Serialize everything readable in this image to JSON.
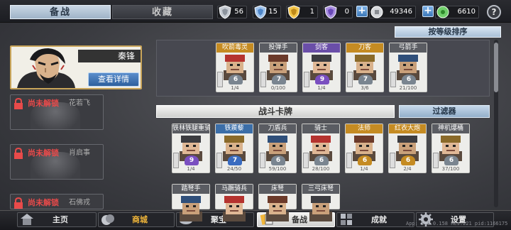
{
  "tabs": {
    "formation": "备战",
    "collection": "收藏"
  },
  "resources": {
    "silver_shield": "56",
    "blue_shield": "15",
    "gold_shield": "1",
    "purple_shield": "0",
    "coins": "49346",
    "gems": "6610"
  },
  "hero": {
    "name": "秦锋",
    "button": "查看详情"
  },
  "locked_slots": [
    {
      "text": "尚未解锁",
      "name": "花若飞"
    },
    {
      "text": "尚未解锁",
      "name": "肖启事"
    },
    {
      "text": "尚未解锁",
      "name": "石佛戎"
    }
  ],
  "sort_button": "按等级排序",
  "section_title": "战斗卡牌",
  "filter_button": "过滤器",
  "equipped_cards": [
    {
      "name": "吹箭毒灵",
      "tier": "gold",
      "level": "6",
      "count": "1/4",
      "badge_color": "#7a8590"
    },
    {
      "name": "投弹手",
      "tier": "gray",
      "level": "7",
      "count": "0/100",
      "badge_color": "#7a8590"
    },
    {
      "name": "剑客",
      "tier": "purple",
      "level": "9",
      "count": "1/4",
      "badge_color": "#7a4fc0"
    },
    {
      "name": "刀客",
      "tier": "gold",
      "level": "7",
      "count": "3/6",
      "badge_color": "#7a8590"
    },
    {
      "name": "弓箭手",
      "tier": "gray",
      "level": "6",
      "count": "21/100",
      "badge_color": "#7a8590"
    }
  ],
  "battle_cards": [
    {
      "name": "铁林铁腿重骑兵",
      "tier": "gray",
      "level": "9",
      "count": "1/4",
      "badge_color": "#7a4fc0"
    },
    {
      "name": "铁蒺藜",
      "tier": "blue",
      "level": "7",
      "count": "24/50",
      "badge_color": "#3a6cc0"
    },
    {
      "name": "刀盾兵",
      "tier": "gray",
      "level": "6",
      "count": "59/100",
      "badge_color": "#7a8590"
    },
    {
      "name": "骑士",
      "tier": "gray",
      "level": "6",
      "count": "28/100",
      "badge_color": "#7a8590"
    },
    {
      "name": "法师",
      "tier": "gold",
      "level": "6",
      "count": "1/4",
      "badge_color": "#c58b22"
    },
    {
      "name": "红衣大炮",
      "tier": "gold",
      "level": "6",
      "count": "2/4",
      "badge_color": "#c58b22"
    },
    {
      "name": "神机爆桶",
      "tier": "gray",
      "level": "6",
      "count": "37/100",
      "badge_color": "#7a8590"
    }
  ],
  "battle_cards_row2": [
    {
      "name": "踏弩手",
      "tier": "gray"
    },
    {
      "name": "马蹶骑兵",
      "tier": "gray"
    },
    {
      "name": "床弩",
      "tier": "gray"
    },
    {
      "name": "三弓床弩",
      "tier": "gray"
    }
  ],
  "nav": {
    "home": "主页",
    "shop": "商城",
    "treasure": "聚宝",
    "formation": "备战",
    "achievement": "成就",
    "settings": "设置"
  },
  "version": "App: 1.1.0.158 Res:221 pid:1166175"
}
